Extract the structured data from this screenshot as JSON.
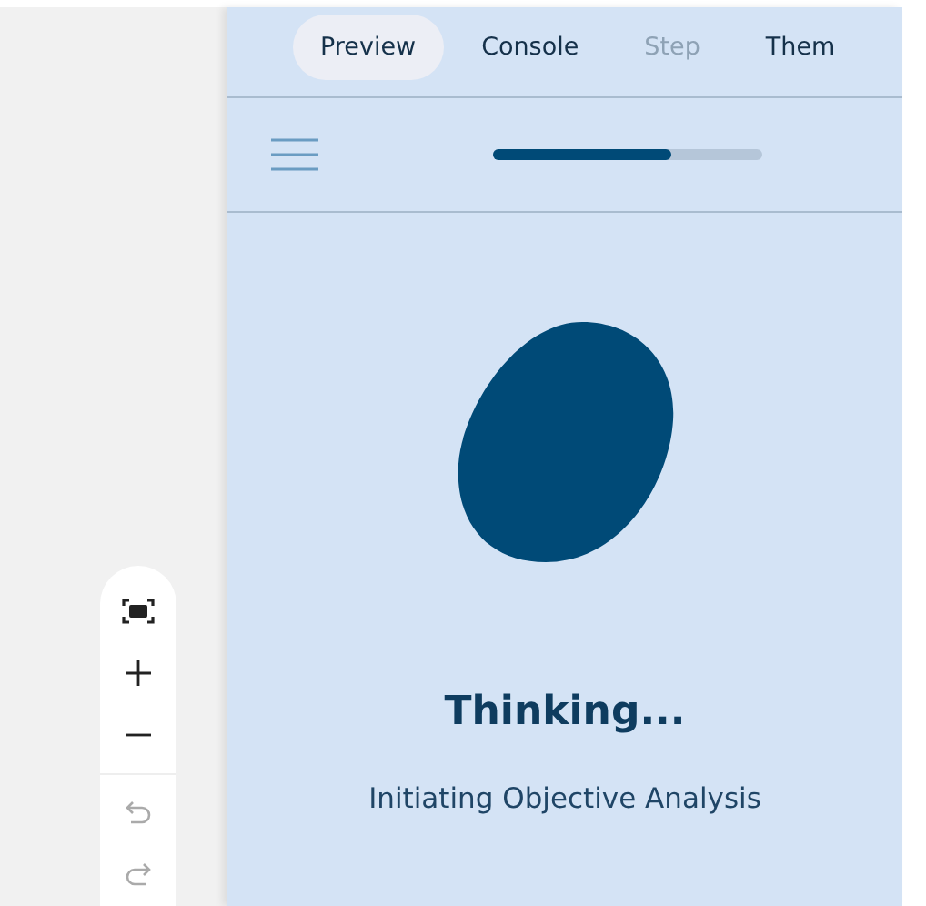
{
  "tabs": [
    {
      "label": "Preview",
      "selected": true,
      "disabled": false
    },
    {
      "label": "Console",
      "selected": false,
      "disabled": false
    },
    {
      "label": "Step",
      "selected": false,
      "disabled": true
    },
    {
      "label": "Them",
      "selected": false,
      "disabled": false
    }
  ],
  "progress": {
    "level": 0.66
  },
  "status": {
    "title": "Thinking...",
    "subtitle": "Initiating Objective Analysis"
  },
  "zoom_controls": [
    {
      "kind": "fit",
      "disabled": false
    },
    {
      "kind": "zoom-in",
      "disabled": false
    },
    {
      "kind": "zoom-out",
      "disabled": false
    },
    {
      "kind": "undo",
      "disabled": true
    },
    {
      "kind": "redo",
      "disabled": true
    }
  ]
}
